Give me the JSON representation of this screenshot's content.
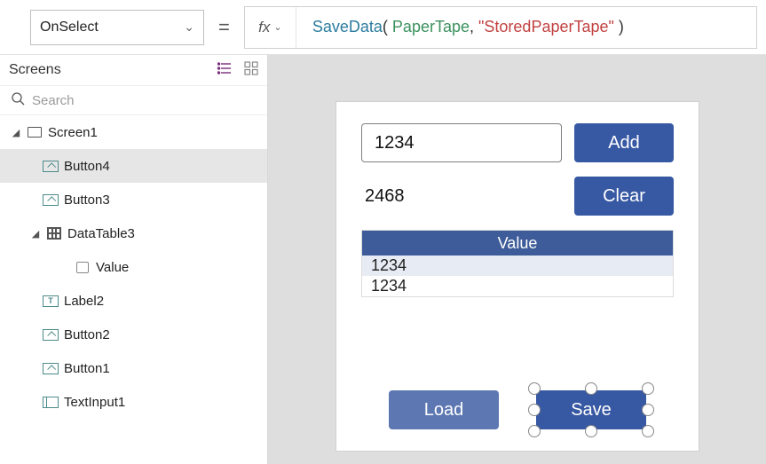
{
  "topbar": {
    "property": "OnSelect",
    "fx": "fx",
    "formula": {
      "fn": "SaveData",
      "open": "( ",
      "arg1": "PaperTape",
      "comma": ", ",
      "arg2": "\"StoredPaperTape\"",
      "close": " )"
    }
  },
  "treepanel": {
    "title": "Screens",
    "search_placeholder": "Search"
  },
  "tree": {
    "screen1": "Screen1",
    "button4": "Button4",
    "button3": "Button3",
    "datatable3": "DataTable3",
    "value": "Value",
    "label2": "Label2",
    "button2": "Button2",
    "button1": "Button1",
    "textinput1": "TextInput1"
  },
  "app": {
    "input_value": "1234",
    "add_label": "Add",
    "sum_value": "2468",
    "clear_label": "Clear",
    "dt_header": "Value",
    "dt_rows": [
      "1234",
      "1234"
    ],
    "load_label": "Load",
    "save_label": "Save"
  }
}
